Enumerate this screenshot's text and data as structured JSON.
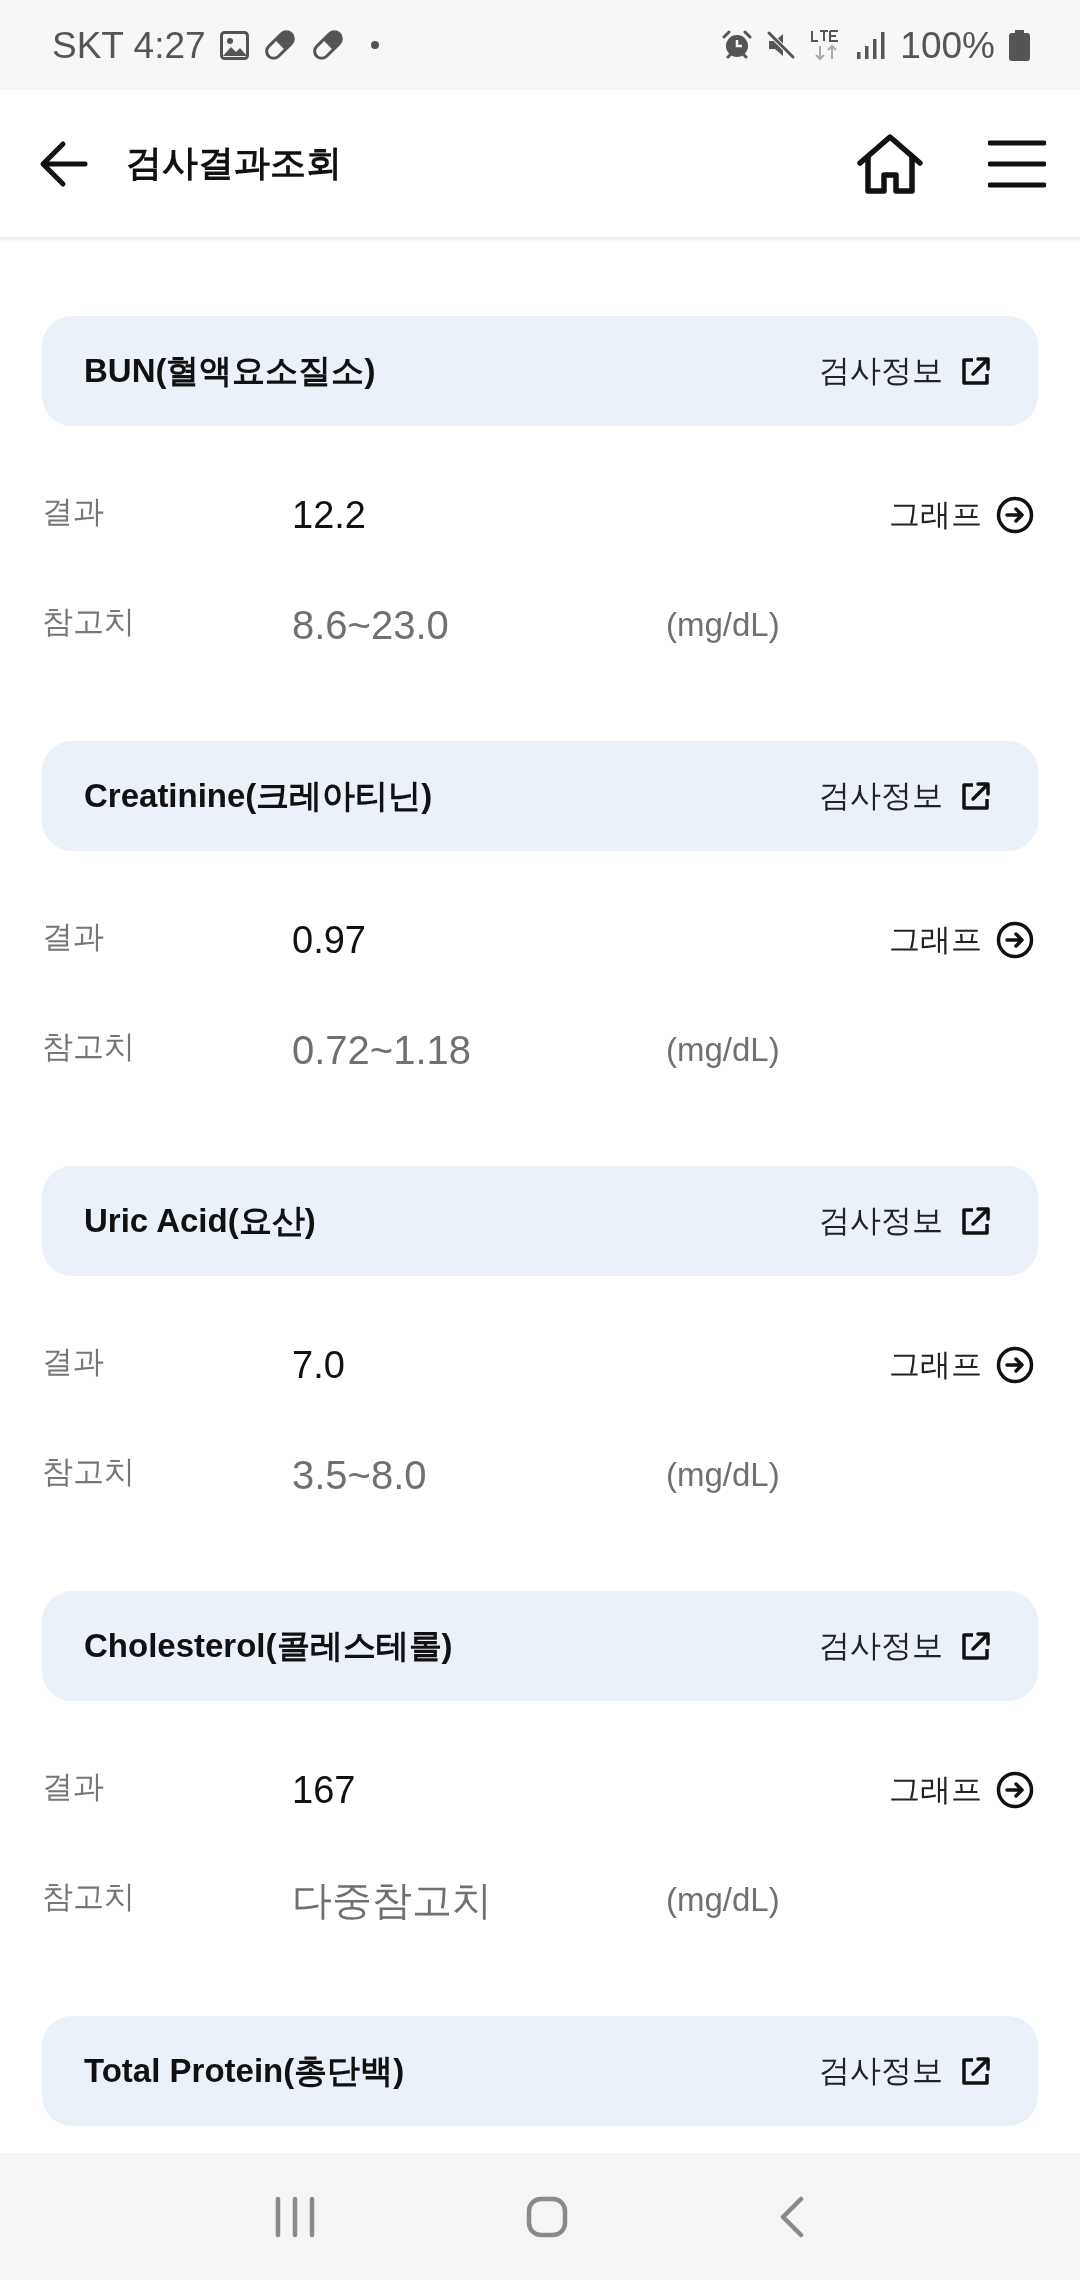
{
  "status_bar": {
    "carrier_time": "SKT 4:27",
    "battery_percent": "100%"
  },
  "app_bar": {
    "title": "검사결과조회"
  },
  "tests": [
    {
      "name": "BUN(혈액요소질소)",
      "info_link": "검사정보",
      "result_label": "결과",
      "result": "12.2",
      "graph_link": "그래프",
      "reference_label": "참고치",
      "reference": "8.6~23.0",
      "unit": "(mg/dL)"
    },
    {
      "name": "Creatinine(크레아티닌)",
      "info_link": "검사정보",
      "result_label": "결과",
      "result": "0.97",
      "graph_link": "그래프",
      "reference_label": "참고치",
      "reference": "0.72~1.18",
      "unit": "(mg/dL)"
    },
    {
      "name": "Uric Acid(요산)",
      "info_link": "검사정보",
      "result_label": "결과",
      "result": "7.0",
      "graph_link": "그래프",
      "reference_label": "참고치",
      "reference": "3.5~8.0",
      "unit": "(mg/dL)"
    },
    {
      "name": "Cholesterol(콜레스테롤)",
      "info_link": "검사정보",
      "result_label": "결과",
      "result": "167",
      "graph_link": "그래프",
      "reference_label": "참고치",
      "reference": "다중참고치",
      "unit": "(mg/dL)"
    },
    {
      "name": "Total Protein(총단백)",
      "info_link": "검사정보"
    }
  ]
}
